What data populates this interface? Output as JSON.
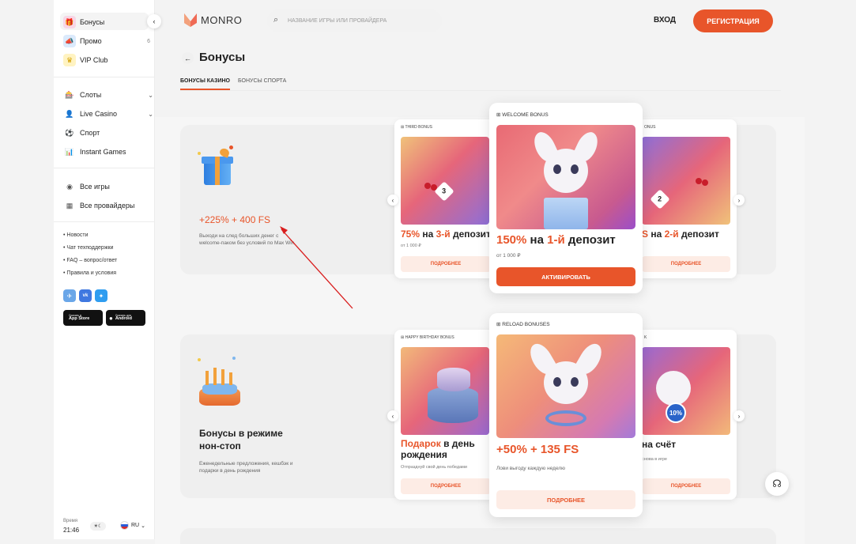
{
  "sidebar": {
    "items_top": [
      {
        "label": "Бонусы",
        "icon": "gift-icon"
      },
      {
        "label": "Промо",
        "icon": "promo-icon",
        "count": "6"
      },
      {
        "label": "VIP Club",
        "icon": "crown-icon"
      }
    ],
    "items_mid": [
      {
        "label": "Слоты",
        "icon": "slot-icon"
      },
      {
        "label": "Live Casino",
        "icon": "dealer-icon"
      },
      {
        "label": "Спорт",
        "icon": "ball-icon"
      },
      {
        "label": "Instant Games",
        "icon": "chart-icon"
      }
    ],
    "items_bot": [
      {
        "label": "Все игры",
        "icon": "games-icon"
      },
      {
        "label": "Все провайдеры",
        "icon": "grid-icon"
      }
    ],
    "links": [
      "Новости",
      "Чат техподдержки",
      "FAQ – вопрос/ответ",
      "Правила и условия"
    ],
    "app_store": {
      "small": "Скачать в",
      "big": "App Store"
    },
    "android": {
      "small": "Скачать для",
      "big": "Android"
    },
    "time_label": "Время",
    "time": "21:46",
    "lang": "RU"
  },
  "header": {
    "logo": "MONRO",
    "search_placeholder": "НАЗВАНИЕ ИГРЫ ИЛИ ПРОВАЙДЕРА",
    "login": "ВХОД",
    "register": "РЕГИСТРАЦИЯ"
  },
  "page": {
    "title": "Бонусы",
    "tabs": [
      "БОНУСЫ КАЗИНО",
      "БОНУСЫ СПОРТА"
    ]
  },
  "section1": {
    "headline": "+225% + 400 FS",
    "desc": "Выходи на след больших денег с welcome-паком без условий по Max Win",
    "cards": [
      {
        "label": "THIRD BONUS",
        "title_a": "75%",
        "title_b": " на ",
        "title_c": "3-й",
        "title_d": " депозит",
        "sub": "от 1 000 ₽",
        "btn": "ПОДРОБНЕЕ",
        "badge": "3"
      },
      {
        "label": "WELCOME BONUS",
        "title_a": "150%",
        "title_b": " на ",
        "title_c": "1-й",
        "title_d": " депозит",
        "sub": "от 1 000 ₽",
        "btn": "АКТИВИРОВАТЬ"
      },
      {
        "label": "ONUS",
        "title_a": "S",
        "title_b": " на ",
        "title_c": "2-й",
        "title_d": " депозит",
        "sub": "",
        "btn": "ПОДРОБНЕЕ",
        "badge": "2"
      }
    ]
  },
  "section2": {
    "headline": "Бонусы в режиме нон-стоп",
    "desc": "Еженедельные предложения, кешбэк и подарки в день рождения",
    "cards": [
      {
        "label": "HAPPY BIRTHDAY BONUS",
        "title_a": "Подарок",
        "title_b": " в день рождения",
        "sub": "Отпразднуй свой день победами",
        "btn": "ПОДРОБНЕЕ"
      },
      {
        "label": "RELOAD BONUSES",
        "title": "+50% + 135 FS",
        "sub": "Лови выгоду каждую неделю",
        "btn": "ПОДРОБНЕЕ"
      },
      {
        "label": "K",
        "title": "на счёт",
        "sub": "снова в игре",
        "btn": "ПОДРОБНЕЕ",
        "badge": "10%"
      }
    ]
  },
  "colors": {
    "accent": "#e8552a",
    "bg": "#f6f6f6"
  }
}
